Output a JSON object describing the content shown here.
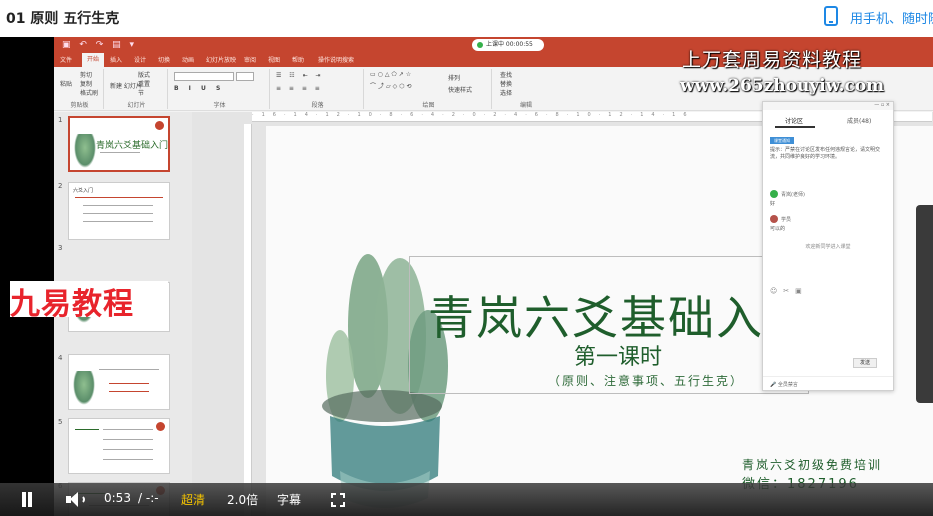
{
  "page": {
    "title": "01 原则 五行生克",
    "mobile_link": "用手机、随时随"
  },
  "ppt": {
    "recording_status": "上课中 00:00:55",
    "tabs": [
      "文件",
      "开始",
      "插入",
      "设计",
      "切换",
      "动画",
      "幻灯片放映",
      "审阅",
      "视图",
      "帮助",
      "操作说明搜索"
    ],
    "ribbon": {
      "cut": "剪切",
      "copy": "复制",
      "format_painter": "格式刷",
      "paste": "粘贴",
      "new_slide": "新建\n幻灯片",
      "layout": "版式",
      "reset": "重置",
      "section": "节",
      "groups": [
        "剪贴板",
        "幻灯片",
        "字体",
        "段落",
        "绘图",
        "编辑"
      ],
      "find": "查找",
      "replace": "替换",
      "select": "选择",
      "arrange": "排列",
      "quick_styles": "快速样式"
    }
  },
  "thumbnails": [
    {
      "num": "1",
      "title": "青岚六爻基础入门"
    },
    {
      "num": "2",
      "title": "六爻入门"
    },
    {
      "num": "3",
      "title": ""
    },
    {
      "num": "4",
      "title": ""
    },
    {
      "num": "5",
      "title": ""
    },
    {
      "num": "6",
      "title": ""
    }
  ],
  "watermarks": {
    "left_brand": "九易教程",
    "top_line1": "上万套周易资料教程",
    "top_line2": "www.265zhouyiw.com"
  },
  "slide": {
    "title": "青岚六爻基础入",
    "subtitle": "第一课时",
    "topics": "（原则、注意事项、五行生克）",
    "footer_line1": "青岚六爻初级免费培训",
    "footer_line2": "微信：1827196"
  },
  "chat": {
    "tab_discussion": "讨论区",
    "tab_members": "成员(48)",
    "tag": "课堂通知",
    "notice_text": "提示：严禁在讨论区发布任何违规言论，请文明交流，共同维护良好的学习环境。",
    "user1_name": "青岚(老师)",
    "user1_msg": "好",
    "user2_name": "学员",
    "user2_msg": "可以的",
    "join_notice": "欢迎新同学进入课堂",
    "send_label": "发送",
    "bottom_text": "全员禁言"
  },
  "player": {
    "current_time": "0:53",
    "duration": "/ -:-",
    "quality": "超清",
    "speed": "2.0倍",
    "subtitles": "字幕"
  },
  "colors": {
    "ppt_accent": "#c5452f",
    "slide_green": "#1f5e2c",
    "quality_highlight": "#f5c400",
    "link_blue": "#1e88e5"
  }
}
